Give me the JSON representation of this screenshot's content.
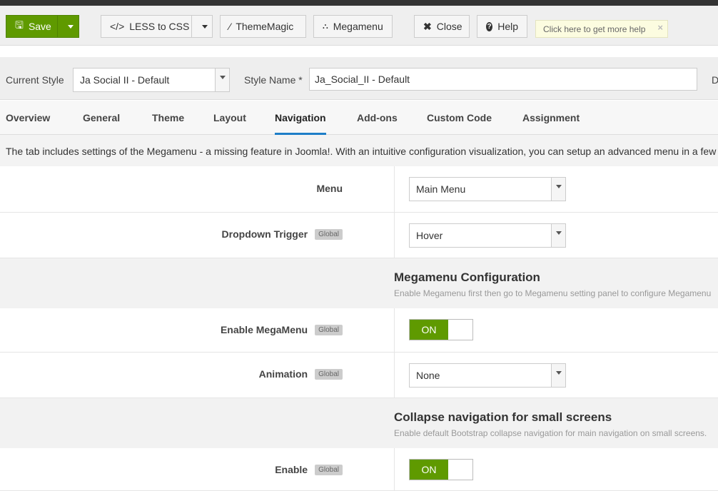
{
  "toolbar": {
    "save": "Save",
    "less": "LESS to CSS",
    "thememagic": "ThemeMagic",
    "megamenu": "Megamenu",
    "close": "Close",
    "help": "Help",
    "help_tip": "Click here to get more help",
    "tip_close": "×"
  },
  "style": {
    "current_label": "Current Style",
    "current_value": "Ja Social II - Default",
    "name_label": "Style Name *",
    "name_value": "Ja_Social_II - Default",
    "cut_label": "D"
  },
  "tabs": [
    "Overview",
    "General",
    "Theme",
    "Layout",
    "Navigation",
    "Add-ons",
    "Custom Code",
    "Assignment"
  ],
  "active_tab": "Navigation",
  "description": "The tab includes settings of the Megamenu - a missing feature in Joomla!. With an intuitive configuration visualization, you can setup an advanced menu in a few",
  "fields": {
    "menu": {
      "label": "Menu",
      "value": "Main Menu"
    },
    "dropdown": {
      "label": "Dropdown Trigger",
      "badge": "Global",
      "value": "Hover"
    },
    "mm_section": {
      "title": "Megamenu Configuration",
      "desc": "Enable Megamenu first then go to Megamenu setting panel to configure Megamenu"
    },
    "enable_mm": {
      "label": "Enable MegaMenu",
      "badge": "Global",
      "value": "ON"
    },
    "animation": {
      "label": "Animation",
      "badge": "Global",
      "value": "None"
    },
    "collapse_section": {
      "title": "Collapse navigation for small screens",
      "desc": "Enable default Bootstrap collapse navigation for main navigation on small screens."
    },
    "enable": {
      "label": "Enable",
      "badge": "Global",
      "value": "ON"
    }
  },
  "colors": {
    "save": "#5f9a00",
    "active_tab": "#1e7ec8"
  }
}
